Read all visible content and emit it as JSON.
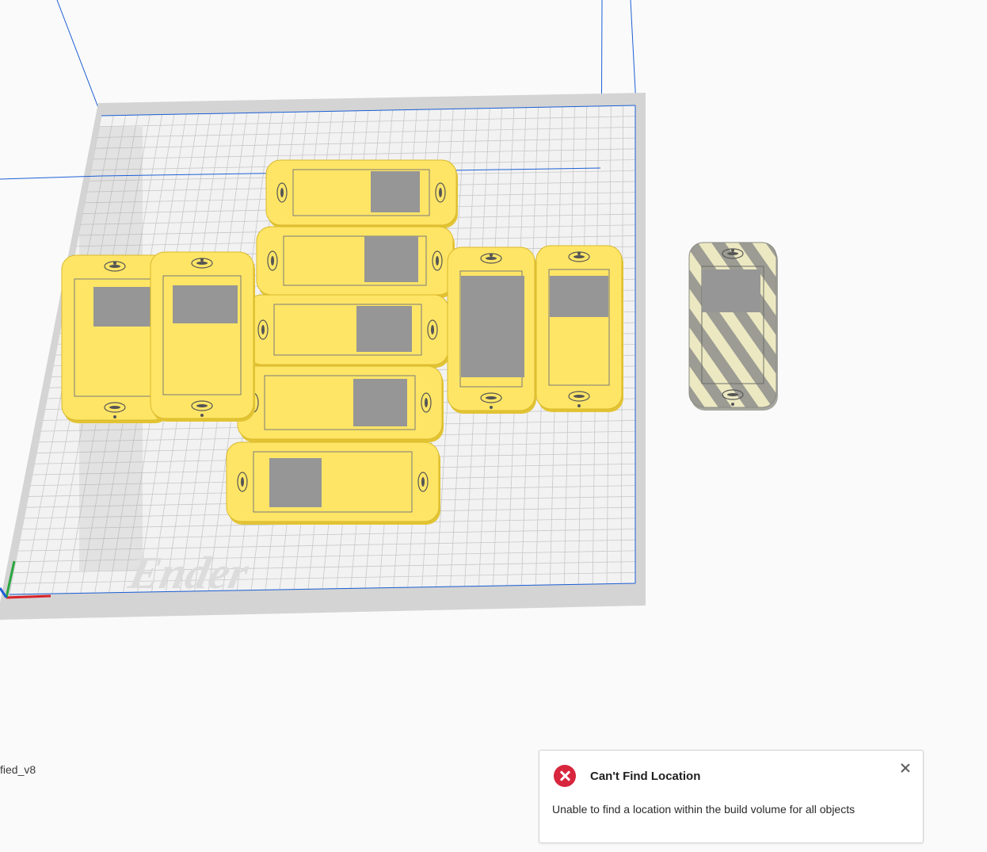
{
  "project": {
    "filename_partial": "fied_v8"
  },
  "scene": {
    "build_plate_logo": "Ender",
    "colors": {
      "background": "#fafafa",
      "plate_frame": "#d4d4d4",
      "plate_surface": "#f2f2f2",
      "grid_line": "#c8c8c8",
      "build_volume_line": "#1d5fd6",
      "object_fill": "#ffe566",
      "object_edge": "#e2c433",
      "cutout_gray": "#969696",
      "out_of_bounds_stripe_a": "#ece9c2",
      "out_of_bounds_stripe_b": "#9c9c94",
      "axis_x": "#d8232a",
      "axis_y": "#2ba640",
      "axis_z": "#1d5fd6"
    }
  },
  "notification": {
    "title": "Can't Find Location",
    "message": "Unable to find a location within the build volume for all objects",
    "icon": "error-circle-icon",
    "close_icon": "close-icon",
    "colors": {
      "icon_bg": "#d7263d",
      "border": "#d2d2d2"
    }
  }
}
